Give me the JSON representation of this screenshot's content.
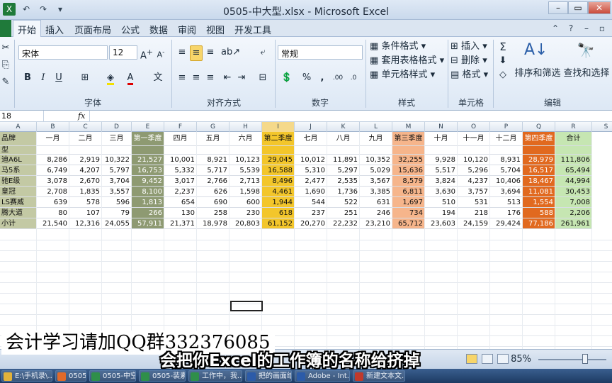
{
  "window": {
    "title": "0505-中大型.xlsx - Microsoft Excel"
  },
  "ribbon_tabs": [
    "开始",
    "插入",
    "页面布局",
    "公式",
    "数据",
    "审阅",
    "视图",
    "开发工具"
  ],
  "ribbon": {
    "font_name": "宋体",
    "font_size": "12",
    "number_format": "常规",
    "font_group": "字体",
    "align_group": "对齐方式",
    "number_group": "数字",
    "styles_group": "样式",
    "cells_group": "单元格",
    "edit_group": "编辑",
    "conditional": "条件格式",
    "table_format": "套用表格格式",
    "cell_styles": "单元格样式",
    "insert": "插入",
    "delete": "删除",
    "format": "格式",
    "sort_filter": "排序和筛选",
    "find_select": "查找和选择",
    "percent": "%",
    "comma": ","
  },
  "formula_bar": {
    "name_box": "18",
    "fx": "fx",
    "content": ""
  },
  "columns": [
    "A",
    "B",
    "C",
    "D",
    "E",
    "F",
    "G",
    "H",
    "I",
    "J",
    "K",
    "L",
    "M",
    "N",
    "O",
    "P",
    "Q",
    "R",
    "S"
  ],
  "header_row": {
    "label": "品牌",
    "cols": [
      "一月",
      "二月",
      "三月",
      "第一季度",
      "四月",
      "五月",
      "六月",
      "第二季度",
      "七月",
      "八月",
      "九月",
      "第三季度",
      "十月",
      "十一月",
      "十二月",
      "第四季度",
      "合计"
    ]
  },
  "sub_row": {
    "label": "型"
  },
  "rows": [
    {
      "label": "迪A6L",
      "values": [
        "8,286",
        "2,919",
        "10,322",
        "21,527",
        "10,001",
        "8,921",
        "10,123",
        "29,045",
        "10,012",
        "11,891",
        "10,352",
        "32,255",
        "9,928",
        "10,120",
        "8,931",
        "28,979",
        "111,806"
      ]
    },
    {
      "label": "马5系",
      "values": [
        "6,749",
        "4,207",
        "5,797",
        "16,753",
        "5,332",
        "5,717",
        "5,539",
        "16,588",
        "5,310",
        "5,297",
        "5,029",
        "15,636",
        "5,517",
        "5,296",
        "5,704",
        "16,517",
        "65,494"
      ]
    },
    {
      "label": "驰E级",
      "values": [
        "3,078",
        "2,670",
        "3,704",
        "9,452",
        "3,017",
        "2,766",
        "2,713",
        "8,496",
        "2,477",
        "2,535",
        "3,567",
        "8,579",
        "3,824",
        "4,237",
        "10,406",
        "18,467",
        "44,994"
      ]
    },
    {
      "label": "皇冠",
      "values": [
        "2,708",
        "1,835",
        "3,557",
        "8,100",
        "2,237",
        "626",
        "1,598",
        "4,461",
        "1,690",
        "1,736",
        "3,385",
        "6,811",
        "3,630",
        "3,757",
        "3,694",
        "11,081",
        "30,453"
      ]
    },
    {
      "label": "LS赛威",
      "values": [
        "639",
        "578",
        "596",
        "1,813",
        "654",
        "690",
        "600",
        "1,944",
        "544",
        "522",
        "631",
        "1,697",
        "510",
        "531",
        "513",
        "1,554",
        "7,008"
      ]
    },
    {
      "label": "腾大道",
      "values": [
        "80",
        "107",
        "79",
        "266",
        "130",
        "258",
        "230",
        "618",
        "237",
        "251",
        "246",
        "734",
        "194",
        "218",
        "176",
        "588",
        "2,206"
      ]
    },
    {
      "label": "小计",
      "values": [
        "21,540",
        "12,316",
        "24,055",
        "57,911",
        "21,371",
        "18,978",
        "20,803",
        "61,152",
        "20,270",
        "22,232",
        "23,210",
        "65,712",
        "23,603",
        "24,159",
        "29,424",
        "77,186",
        "261,961"
      ]
    }
  ],
  "status": {
    "zoom": "85%"
  },
  "taskbar": [
    "E:\\手机录\\...",
    "0505-中大...",
    "0505-中空...",
    "0505-装素...",
    "工作中，我...",
    "把的画面给...",
    "Adobe - Int...",
    "新建文本文..."
  ],
  "overlay": {
    "watermark": "会计学习请加QQ群332376085",
    "subtitle": "会把你Excel的工作簿的名称给挤掉"
  },
  "colors": {
    "q1": "#8e9a72",
    "q2": "#f3c62b",
    "q3": "#f6b58b",
    "q4": "#e1691f",
    "total": "#c6e6b2",
    "label_col": "#c3c9a4"
  }
}
